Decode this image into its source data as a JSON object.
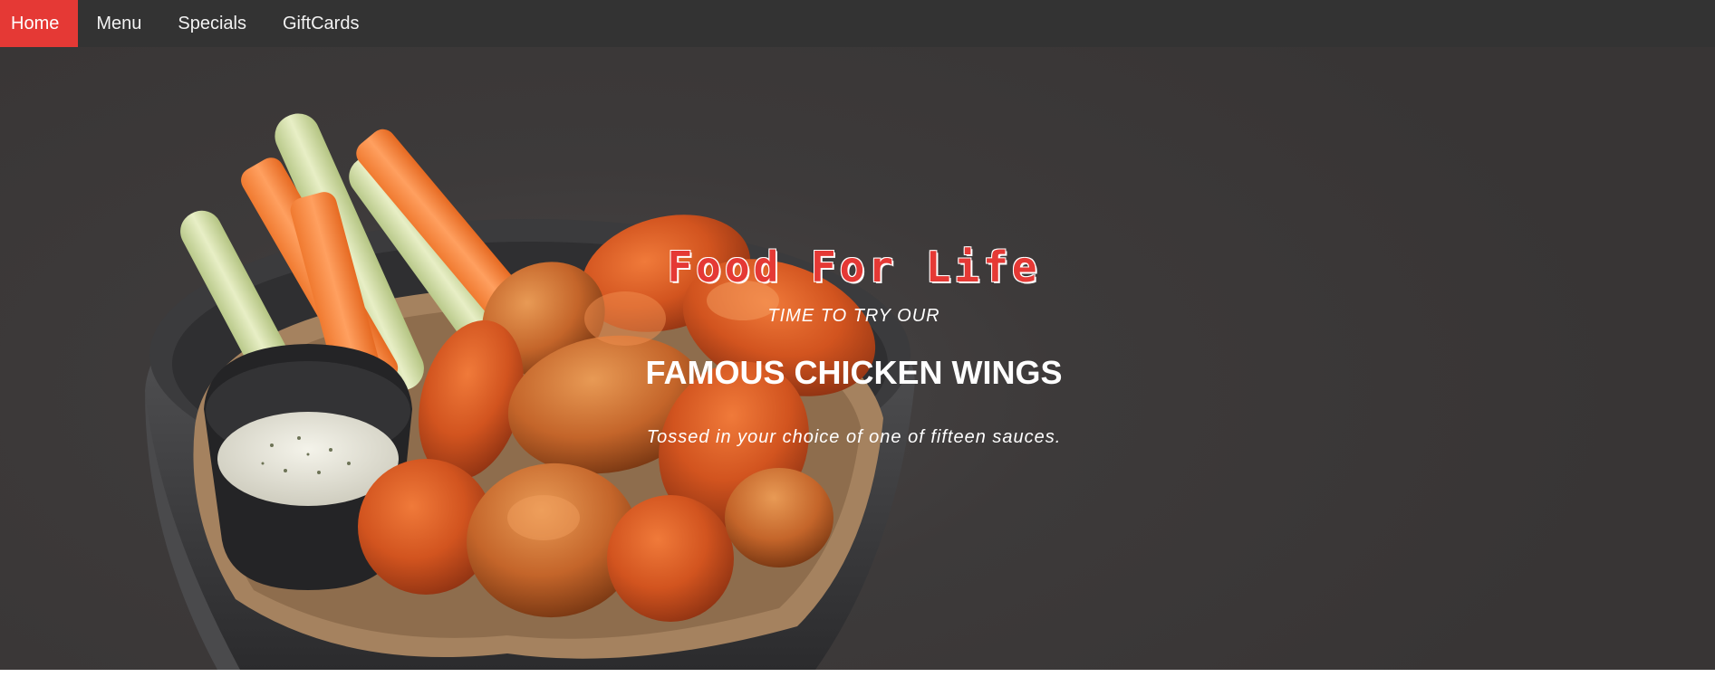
{
  "nav": {
    "items": [
      {
        "label": "Home",
        "active": true
      },
      {
        "label": "Menu",
        "active": false
      },
      {
        "label": "Specials",
        "active": false
      },
      {
        "label": "GiftCards",
        "active": false
      }
    ]
  },
  "hero": {
    "title": "Food For Life",
    "kicker": "TIME TO TRY OUR",
    "headline": "FAMOUS CHICKEN WINGS",
    "tagline": "Tossed in your choice of one of fifteen sauces.",
    "image": "chicken-wings-bowl-with-celery-carrots-and-ranch"
  },
  "colors": {
    "navbar": "#333333",
    "accent": "#e53935",
    "hero_bg": "#3d3a3a",
    "text": "#ffffff"
  }
}
